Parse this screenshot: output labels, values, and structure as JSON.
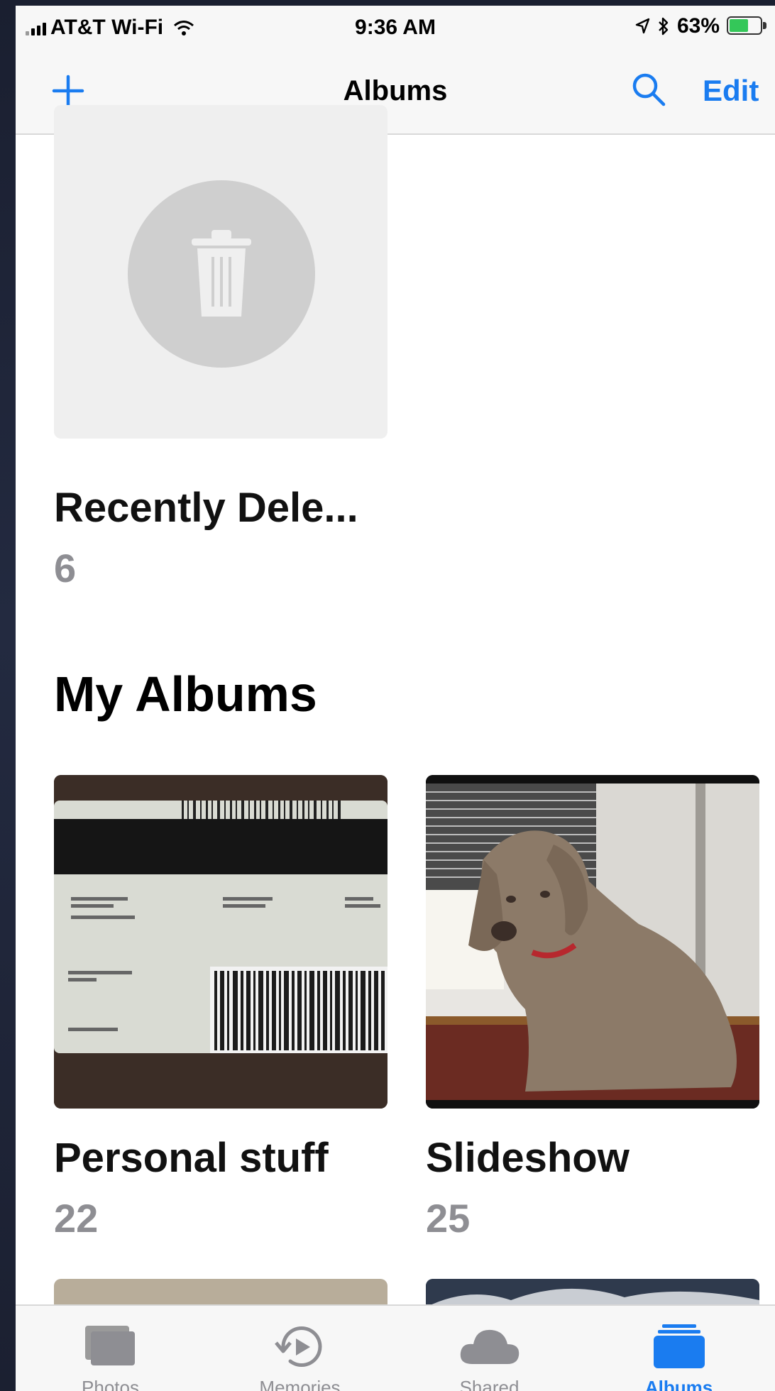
{
  "status_bar": {
    "carrier": "AT&T Wi-Fi",
    "time": "9:36 AM",
    "battery": "63%",
    "battery_level": 0.63
  },
  "nav": {
    "title": "Albums",
    "edit_label": "Edit",
    "add_icon": "plus-icon",
    "search_icon": "search-icon"
  },
  "recently_deleted": {
    "name": "Recently Dele...",
    "count": "6",
    "icon": "trash-icon"
  },
  "my_albums": {
    "title": "My Albums",
    "albums": [
      {
        "name": "Personal stuff",
        "count": "22"
      },
      {
        "name": "Slideshow",
        "count": "25"
      }
    ]
  },
  "tabs": [
    {
      "label": "Photos",
      "icon": "photos-icon",
      "active": false
    },
    {
      "label": "Memories",
      "icon": "memories-icon",
      "active": false
    },
    {
      "label": "Shared",
      "icon": "cloud-icon",
      "active": false
    },
    {
      "label": "Albums",
      "icon": "albums-icon",
      "active": true
    }
  ],
  "colors": {
    "accent": "#1a7cf0",
    "battery_fill": "#34c759",
    "count_gray": "#8e8e93"
  }
}
